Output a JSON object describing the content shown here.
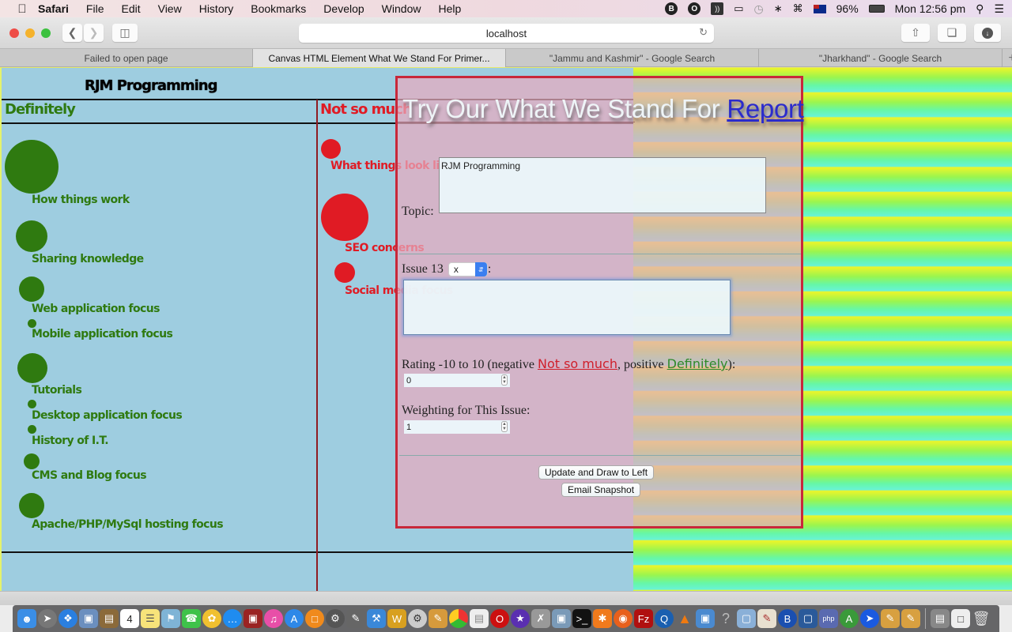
{
  "menubar": {
    "app": "Safari",
    "items": [
      "File",
      "Edit",
      "View",
      "History",
      "Bookmarks",
      "Develop",
      "Window",
      "Help"
    ],
    "status": {
      "battery": "96%",
      "clock": "Mon 12:56 pm"
    }
  },
  "toolbar": {
    "url": "localhost"
  },
  "tabs": [
    {
      "label": "Failed to open page",
      "active": false
    },
    {
      "label": "Canvas HTML Element What We Stand For Primer...",
      "active": true
    },
    {
      "label": "\"Jammu and Kashmir\" - Google Search",
      "active": false
    },
    {
      "label": "\"Jharkhand\" - Google Search",
      "active": false
    }
  ],
  "canvas": {
    "title": "RJM Programming",
    "positive_heading": "Definitely",
    "negative_heading": "Not so much",
    "positive_color": "#2f7a10",
    "negative_color": "#e01b24",
    "positive_items": [
      {
        "label": "How things work"
      },
      {
        "label": "Sharing knowledge"
      },
      {
        "label": "Web application focus"
      },
      {
        "label": "Mobile application focus"
      },
      {
        "label": "Tutorials"
      },
      {
        "label": "Desktop application focus"
      },
      {
        "label": "History of I.T."
      },
      {
        "label": "CMS and Blog focus"
      },
      {
        "label": "Apache/PHP/MySql hosting focus"
      }
    ],
    "negative_items": [
      {
        "label": "What things look like"
      },
      {
        "label": "SEO concerns"
      },
      {
        "label": "Social media focus"
      }
    ]
  },
  "form": {
    "title_prefix": "Try Our What We Stand For",
    "title_link": "Report",
    "topic_label": "Topic:",
    "topic_value": "RJM Programming",
    "issue_label": "Issue 13",
    "issue_select_value": "x",
    "issue_colon": ":",
    "issue_text": "",
    "rating_label_prefix": "Rating -10 to 10 (negative",
    "rating_neg_link": "Not so much",
    "rating_mid": ",  positive",
    "rating_pos_link": "Definitely",
    "rating_suffix": "):",
    "rating_value": "0",
    "weighting_label": "Weighting for This Issue:",
    "weighting_value": "1",
    "update_button": "Update and Draw to Left",
    "email_button": "Email Snapshot"
  },
  "dock": {
    "apps": [
      "Finder",
      "Launchpad",
      "Safari",
      "Preview",
      "Notebook",
      "Calendar",
      "Notes",
      "Maps",
      "FaceTime",
      "Photos",
      "Messages",
      "Photo Booth",
      "iTunes",
      "App Store",
      "iBooks",
      "System Preferences",
      "GIMP",
      "Xcode",
      "FileZilla Web",
      "Automator",
      "Pages",
      "Chrome",
      "TextEdit",
      "Opera",
      "iMovie",
      "Script Editor",
      "Image Capture",
      "Terminal",
      "Avast",
      "Firefox",
      "FileZilla",
      "QuickTime",
      "VLC",
      "Screen Sharing",
      "Help",
      "Cube",
      "Pages 2",
      "BBEdit",
      "VirtualBox",
      "PHP",
      "Android Studio",
      "Blue",
      "Edit 1",
      "Edit 2",
      "Documents",
      "Downloads",
      "Trash"
    ]
  }
}
